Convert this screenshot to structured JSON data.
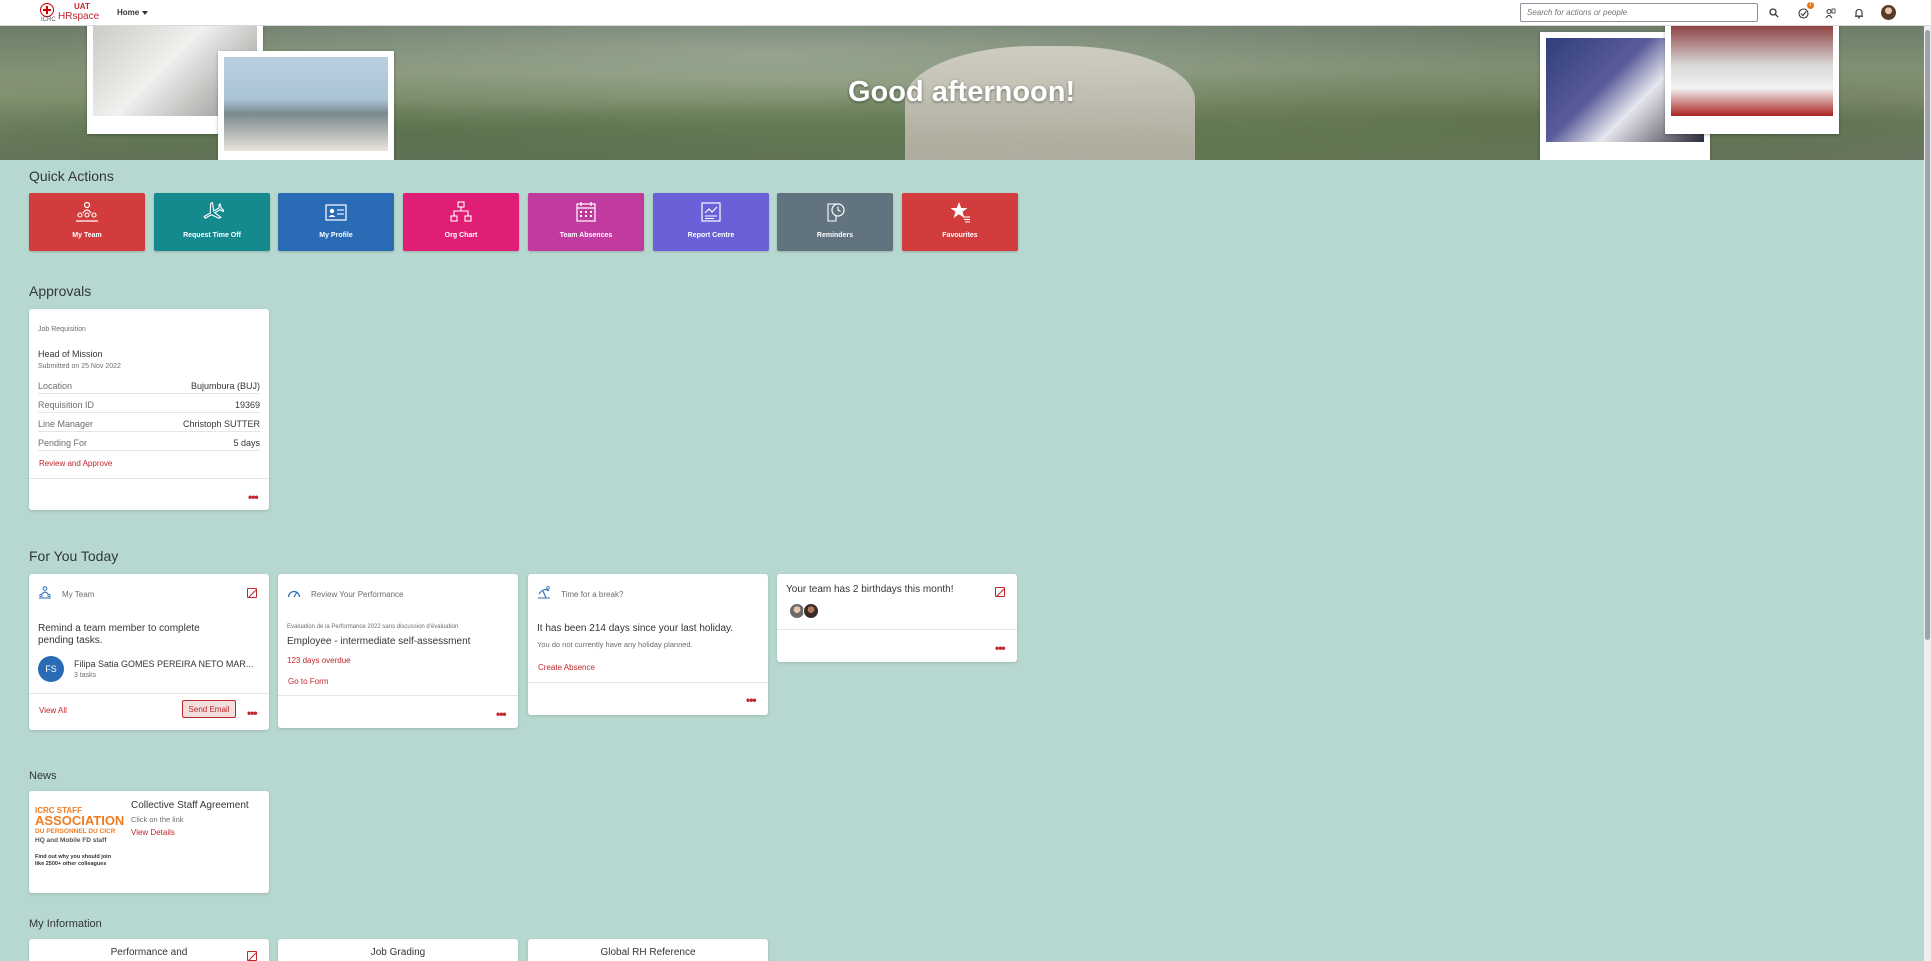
{
  "shell": {
    "logo_org": "ICRC",
    "logo_uat": "UAT",
    "logo_space": "HRspace",
    "home_label": "Home",
    "search_placeholder": "Search for actions or people",
    "notifications_badge": "1"
  },
  "hero": {
    "greeting": "Good afternoon!"
  },
  "quick_actions": {
    "title": "Quick Actions",
    "items": [
      {
        "label": "My Team",
        "color": "#d23c3c",
        "icon": "team-icon"
      },
      {
        "label": "Request Time Off",
        "color": "#148a8f",
        "icon": "airplane-icon"
      },
      {
        "label": "My Profile",
        "color": "#2a6bb5",
        "icon": "profile-card-icon"
      },
      {
        "label": "Org Chart",
        "color": "#e01e75",
        "icon": "org-chart-icon"
      },
      {
        "label": "Team Absences",
        "color": "#c13a9e",
        "icon": "calendar-icon"
      },
      {
        "label": "Report Centre",
        "color": "#6a61d8",
        "icon": "report-icon"
      },
      {
        "label": "Reminders",
        "color": "#627380",
        "icon": "reminder-clock-icon"
      },
      {
        "label": "Favourites",
        "color": "#d23c3c",
        "icon": "star-list-icon"
      }
    ]
  },
  "approvals": {
    "title": "Approvals",
    "card": {
      "type": "Job Requisition",
      "position": "Head of Mission",
      "submitted": "Submitted on 25 Nov 2022",
      "fields": [
        {
          "label": "Location",
          "value": "Bujumbura (BUJ)"
        },
        {
          "label": "Requisition ID",
          "value": "19369"
        },
        {
          "label": "Line Manager",
          "value": "Christoph SUTTER"
        },
        {
          "label": "Pending For",
          "value": "5 days"
        }
      ],
      "action": "Review and Approve"
    }
  },
  "for_you_today": {
    "title": "For You Today",
    "my_team": {
      "header": "My Team",
      "message": "Remind a team member to complete pending tasks.",
      "person_initials": "FS",
      "person_name": "Filipa Satia GOMES PEREIRA NETO MAR...",
      "person_tasks": "3 tasks",
      "view_all": "View All",
      "send_email": "Send Email"
    },
    "performance": {
      "header": "Review Your Performance",
      "form_title": "Evaluation de la Performance 2022 sans discussion d'évaluation",
      "step": "Employee - intermediate self-assessment",
      "overdue": "123 days overdue",
      "action": "Go to Form"
    },
    "break": {
      "header": "Time for a break?",
      "message": "It has been 214 days since your last holiday.",
      "sub": "You do not currently have any holiday planned.",
      "action": "Create Absence"
    },
    "birthdays": {
      "message": "Your team has 2 birthdays this month!"
    }
  },
  "news": {
    "title": "News",
    "card": {
      "banner_line1": "ICRC STAFF",
      "banner_line2": "ASSOCIATION",
      "banner_line3": "DU PERSONNEL DU CICR",
      "banner_line4": "HQ and Mobile FD staff",
      "banner_line5": "Find out why you should join",
      "banner_line6": "like 2500+ other colleagues",
      "headline": "Collective Staff Agreement",
      "sub": "Click on the link",
      "action": "View Details"
    }
  },
  "my_information": {
    "title": "My Information",
    "cards": [
      "Performance and",
      "Job Grading",
      "Global RH Reference"
    ]
  }
}
